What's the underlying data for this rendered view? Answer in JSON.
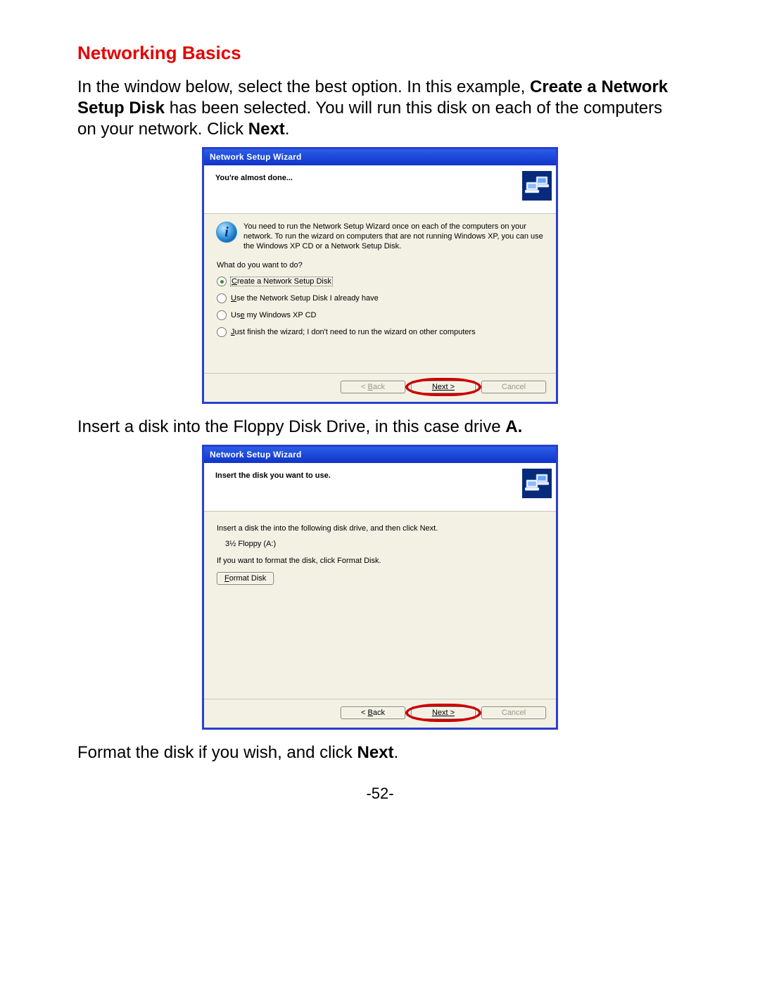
{
  "section_title": "Networking Basics",
  "para1_a": "In the window below, select the best option.    In this example, ",
  "para1_b_bold": "Create a Network Setup Disk",
  "para1_c": " has been selected.    You will run this disk on each of the computers on your network.    Click ",
  "para1_d_bold": "Next",
  "para1_e": ".",
  "para2_a": "Insert a disk into the Floppy Disk Drive, in this case drive ",
  "para2_b_bold": "A.",
  "para3_a": "Format the disk if you wish, and click ",
  "para3_b_bold": "Next",
  "para3_c": ".",
  "page_number": "-52-",
  "wizard1": {
    "title": "Network Setup Wizard",
    "subtitle": "You're almost done...",
    "info_text": "You need to run the Network Setup Wizard once on each of the computers on your network. To run the wizard on computers that are not running Windows XP, you can use the Windows XP CD or a Network Setup Disk.",
    "question": "What do you want to do?",
    "options": [
      {
        "label": "Create a Network Setup Disk",
        "underline_idx": 0,
        "checked": true,
        "focused": true
      },
      {
        "label": "Use the Network Setup Disk I already have",
        "underline_idx": 0,
        "checked": false,
        "focused": false
      },
      {
        "label": "Use my Windows XP CD",
        "underline_idx": 2,
        "checked": false,
        "focused": false
      },
      {
        "label": "Just finish the wizard; I don't need to run the wizard on other computers",
        "underline_idx": 0,
        "checked": false,
        "focused": false
      }
    ],
    "buttons": {
      "back": "< Back",
      "next": "Next >",
      "cancel": "Cancel"
    }
  },
  "wizard2": {
    "title": "Network Setup Wizard",
    "subtitle": "Insert the disk you want to use.",
    "instruction": "Insert a disk the into the following disk drive, and then click Next.",
    "drive": "3½ Floppy (A:)",
    "format_hint": "If you want to format the disk, click Format Disk.",
    "format_button": "Format Disk",
    "buttons": {
      "back": "< Back",
      "next": "Next >",
      "cancel": "Cancel"
    }
  }
}
